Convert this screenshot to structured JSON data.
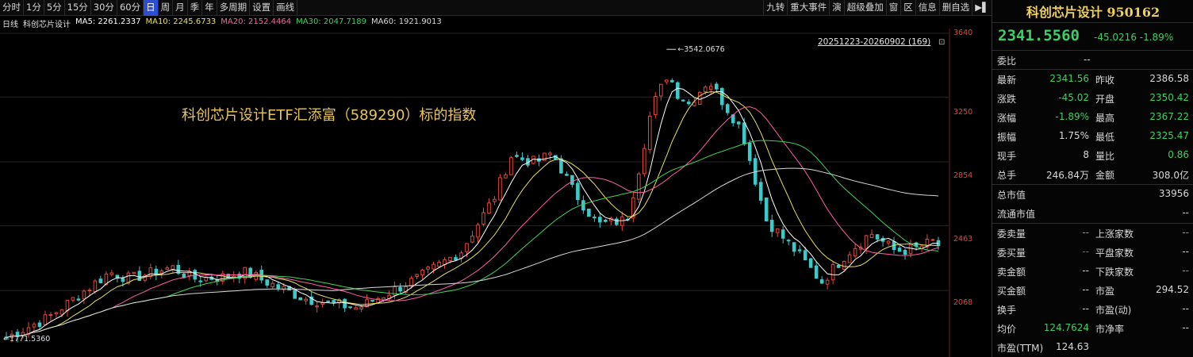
{
  "toolbar": {
    "periods": [
      "分时",
      "1分",
      "5分",
      "15分",
      "30分",
      "60分",
      "日",
      "周",
      "月",
      "季",
      "年",
      "多周期",
      "设置",
      "画线"
    ],
    "active": "日",
    "right_items": [
      "九转",
      "重大事件",
      "演",
      "超级叠加",
      "窗",
      "区",
      "信息",
      "删自选",
      "▶▌"
    ]
  },
  "ma": {
    "period": "日线",
    "name": "科创芯片设计",
    "items": [
      {
        "label": "MA5: 2261.2337",
        "color": "#ffffff"
      },
      {
        "label": "MA10: 2245.6733",
        "color": "#e8e060"
      },
      {
        "label": "MA20: 2152.4464",
        "color": "#ff5fa8"
      },
      {
        "label": "MA30: 2047.7189",
        "color": "#3fd25a"
      },
      {
        "label": "MA60: 1921.9013",
        "color": "#d8d8d8"
      }
    ]
  },
  "chart": {
    "range_label": "20251223-20260902 (169)",
    "caption": "科创芯片设计ETF汇添富（589290）标的指数",
    "high_label": "3542.0676",
    "low_label": "1771.5360",
    "y_ticks": [
      "3640",
      "3250",
      "2854",
      "2463",
      "2068"
    ]
  },
  "chart_data": {
    "type": "candlestick",
    "y_ticks": [
      3640,
      3250,
      2854,
      2463,
      2068
    ],
    "high": 3542.0676,
    "low": 1771.536,
    "last_close": 2341.56,
    "count": 169,
    "up_color": "#e0483a",
    "down_color": "#3ec9c9"
  },
  "panel": {
    "title": "科创芯片设计 950162",
    "price": "2341.5560",
    "change": "-45.0216 -1.89%",
    "weibi": {
      "label": "委比",
      "value": "--"
    },
    "rows": [
      {
        "l1": "最新",
        "v1": "2341.56",
        "c1": "green",
        "l2": "昨收",
        "v2": "2386.58",
        "c2": "val"
      },
      {
        "l1": "涨跌",
        "v1": "-45.02",
        "c1": "green",
        "l2": "开盘",
        "v2": "2350.42",
        "c2": "green"
      },
      {
        "l1": "涨幅",
        "v1": "-1.89%",
        "c1": "green",
        "l2": "最高",
        "v2": "2367.22",
        "c2": "green"
      },
      {
        "l1": "振幅",
        "v1": "1.75%",
        "c1": "val",
        "l2": "最低",
        "v2": "2325.47",
        "c2": "green"
      },
      {
        "l1": "现手",
        "v1": "8",
        "c1": "val",
        "l2": "量比",
        "v2": "0.86",
        "c2": "green"
      },
      {
        "l1": "总手",
        "v1": "246.84万",
        "c1": "val",
        "l2": "金额",
        "v2": "308.0亿",
        "c2": "val"
      }
    ],
    "total_mv": {
      "label": "总市值",
      "value": "33956"
    },
    "float_mv": {
      "label": "流通市值",
      "value": "--"
    },
    "rows2": [
      {
        "l1": "委卖量",
        "v1": "--",
        "c1": "green",
        "l2": "上涨家数",
        "v2": "--",
        "c2": "green"
      },
      {
        "l1": "委买量",
        "v1": "--",
        "c1": "red",
        "l2": "平盘家数",
        "v2": "--",
        "c2": "val"
      },
      {
        "l1": "卖金额",
        "v1": "--",
        "c1": "val",
        "l2": "下跌家数",
        "v2": "--",
        "c2": "green"
      },
      {
        "l1": "买金额",
        "v1": "--",
        "c1": "val",
        "l2": "市盈",
        "v2": "294.52",
        "c2": "val"
      },
      {
        "l1": "换手",
        "v1": "--",
        "c1": "val",
        "l2": "市盈(动)",
        "v2": "--",
        "c2": "val"
      },
      {
        "l1": "均价",
        "v1": "124.7624",
        "c1": "green",
        "l2": "市净率",
        "v2": "--",
        "c2": "val"
      },
      {
        "l1": "市盈(TTM)",
        "v1": "124.63",
        "c1": "val",
        "l2": "",
        "v2": "",
        "c2": "val"
      }
    ]
  }
}
